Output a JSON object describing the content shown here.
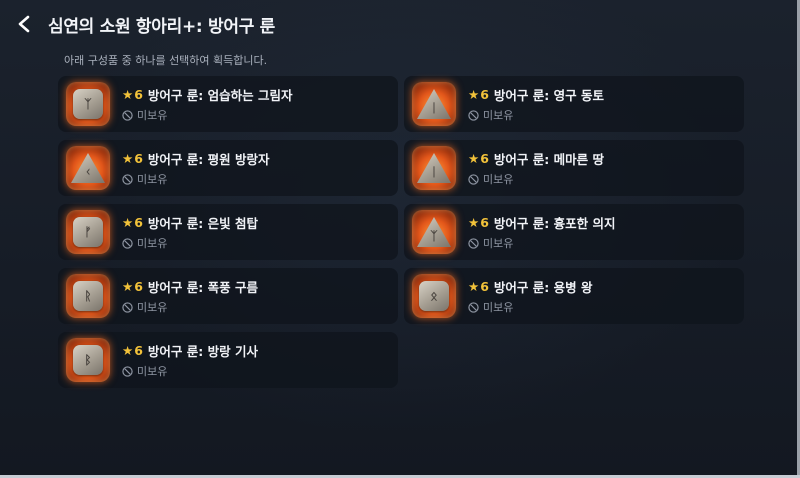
{
  "header": {
    "title": "심연의 소원 항아리+: 방어구 룬",
    "subtitle": "아래 구성품 중 하나를 선택하여 획득합니다."
  },
  "items": [
    {
      "grade": "6",
      "name": "방어구 룬: 엄습하는 그림자",
      "status": "미보유",
      "glyph": "ᛉ",
      "shape": "square"
    },
    {
      "grade": "6",
      "name": "방어구 룬: 영구 동토",
      "status": "미보유",
      "glyph": "ᛁ",
      "shape": "tri"
    },
    {
      "grade": "6",
      "name": "방어구 룬: 평원 방랑자",
      "status": "미보유",
      "glyph": "ᚲ",
      "shape": "tri"
    },
    {
      "grade": "6",
      "name": "방어구 룬: 메마른 땅",
      "status": "미보유",
      "glyph": "ᛁ",
      "shape": "tri"
    },
    {
      "grade": "6",
      "name": "방어구 룬: 은빛 첨탑",
      "status": "미보유",
      "glyph": "ᚠ",
      "shape": "square"
    },
    {
      "grade": "6",
      "name": "방어구 룬: 흉포한 의지",
      "status": "미보유",
      "glyph": "ᛉ",
      "shape": "tri"
    },
    {
      "grade": "6",
      "name": "방어구 룬: 폭풍 구름",
      "status": "미보유",
      "glyph": "ᚱ",
      "shape": "square"
    },
    {
      "grade": "6",
      "name": "방어구 룬: 용병 왕",
      "status": "미보유",
      "glyph": "ᛟ",
      "shape": "square"
    },
    {
      "grade": "6",
      "name": "방어구 룬: 방랑 기사",
      "status": "미보유",
      "glyph": "ᛒ",
      "shape": "square"
    }
  ],
  "icons": {
    "back": "chevron-left-icon",
    "star": "star-icon",
    "status": "not-owned-icon"
  },
  "colors": {
    "accent_star": "#f2c23a",
    "rune_glow": "#e2561a"
  }
}
